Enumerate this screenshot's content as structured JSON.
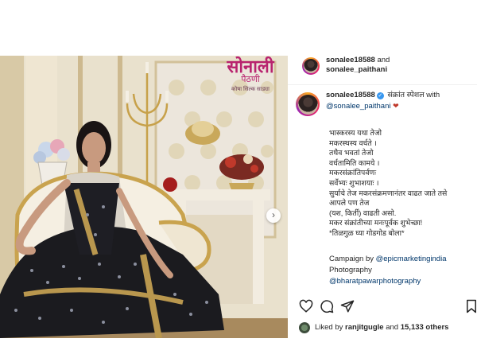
{
  "photo": {
    "brand_main": "सोनाली",
    "brand_sub": "पैठणी",
    "brand_tag": "कोषा सिल्क साड्या"
  },
  "header": {
    "username": "sonalee18588",
    "and": "and",
    "collaborator": "sonalee_paithani"
  },
  "caption": {
    "username": "sonalee18588",
    "title": "संक्रांत स्पेशल with",
    "mention": "@sonalee_paithani",
    "heart": "❤",
    "body": "भास्करस्य यथा तेजो\nमकरस्थस्य वर्धते ।\nतथैव भवतां तेजो\nवर्धतामिति कामये ।\nमकरसंक्रांतिपर्वणः\nसर्वेभ्यः शुभाशयाः ।\nसुर्याचे तेज मकरसंक्रमणानंतर वाढत जाते तसे\nआपले पण तेज\n(यश, किर्ती) वाढती असो.\nमकर संक्रांतीच्या मनःपूर्वक शुभेच्छा!\n*तिळगुळ घ्या गोडगोड बोला*",
    "campaign_label": "Campaign by",
    "campaign_handle": "@epicmarketingindia",
    "photography_label": "Photography",
    "photography_handle": "@bharatpawarphotography"
  },
  "actions": {
    "like_icon": "heart-outline-icon",
    "comment_icon": "comment-bubble-icon",
    "share_icon": "paper-plane-icon",
    "save_icon": "bookmark-icon"
  },
  "likes": {
    "prefix": "Liked by",
    "user": "ranjitgugle",
    "and": "and",
    "count": "15,133 others"
  },
  "colors": {
    "brand_magenta": "#b8236e",
    "link_blue": "#00376b",
    "verified_blue": "#3897f0",
    "saree_black": "#1b1b1f",
    "saree_gold": "#b9974e"
  }
}
